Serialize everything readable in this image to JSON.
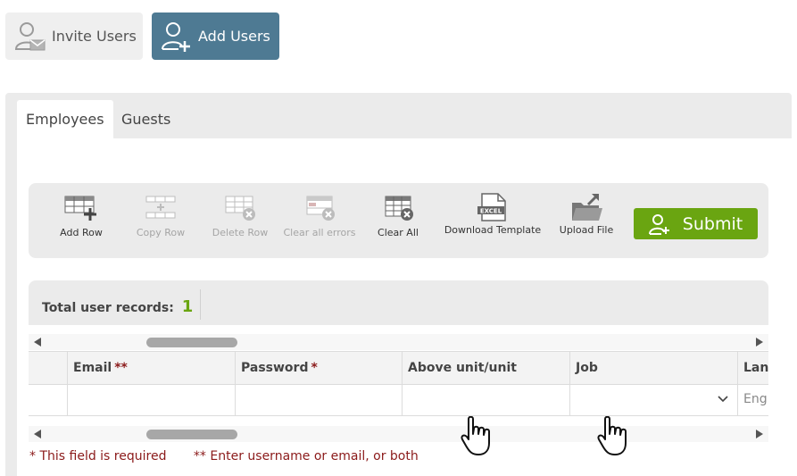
{
  "mode_buttons": {
    "invite_label": "Invite Users",
    "add_label": "Add Users"
  },
  "tabs": [
    {
      "label": "Employees",
      "active": true
    },
    {
      "label": "Guests",
      "active": false
    }
  ],
  "toolbar": {
    "items": [
      {
        "label": "Add Row",
        "icon": "add-row-icon",
        "enabled": true
      },
      {
        "label": "Copy Row",
        "icon": "copy-row-icon",
        "enabled": false
      },
      {
        "label": "Delete Row",
        "icon": "delete-row-icon",
        "enabled": false
      },
      {
        "label": "Clear all errors",
        "icon": "clear-errors-icon",
        "enabled": false
      },
      {
        "label": "Clear All",
        "icon": "clear-all-icon",
        "enabled": true
      },
      {
        "label": "Download Template",
        "icon": "excel-template-icon",
        "enabled": true
      },
      {
        "label": "Upload File",
        "icon": "upload-folder-icon",
        "enabled": true
      }
    ],
    "submit_label": "Submit"
  },
  "records": {
    "label": "Total user records:",
    "count": "1"
  },
  "grid": {
    "columns": [
      {
        "label": "",
        "marker": ""
      },
      {
        "label": "Email",
        "marker": "**"
      },
      {
        "label": "Password",
        "marker": "*"
      },
      {
        "label": "Above unit/unit",
        "marker": ""
      },
      {
        "label": "Job",
        "marker": ""
      },
      {
        "label": "Lang",
        "marker": ""
      }
    ],
    "row": {
      "email": "",
      "password": "",
      "above_unit": "",
      "job": "",
      "language": "Eng"
    }
  },
  "notes": {
    "required": "* This field is required",
    "username_or_email": "** Enter username or email, or both"
  },
  "colors": {
    "accent": "#4e7a93",
    "submit": "#6aa511",
    "required_text": "#8b1a1a"
  }
}
